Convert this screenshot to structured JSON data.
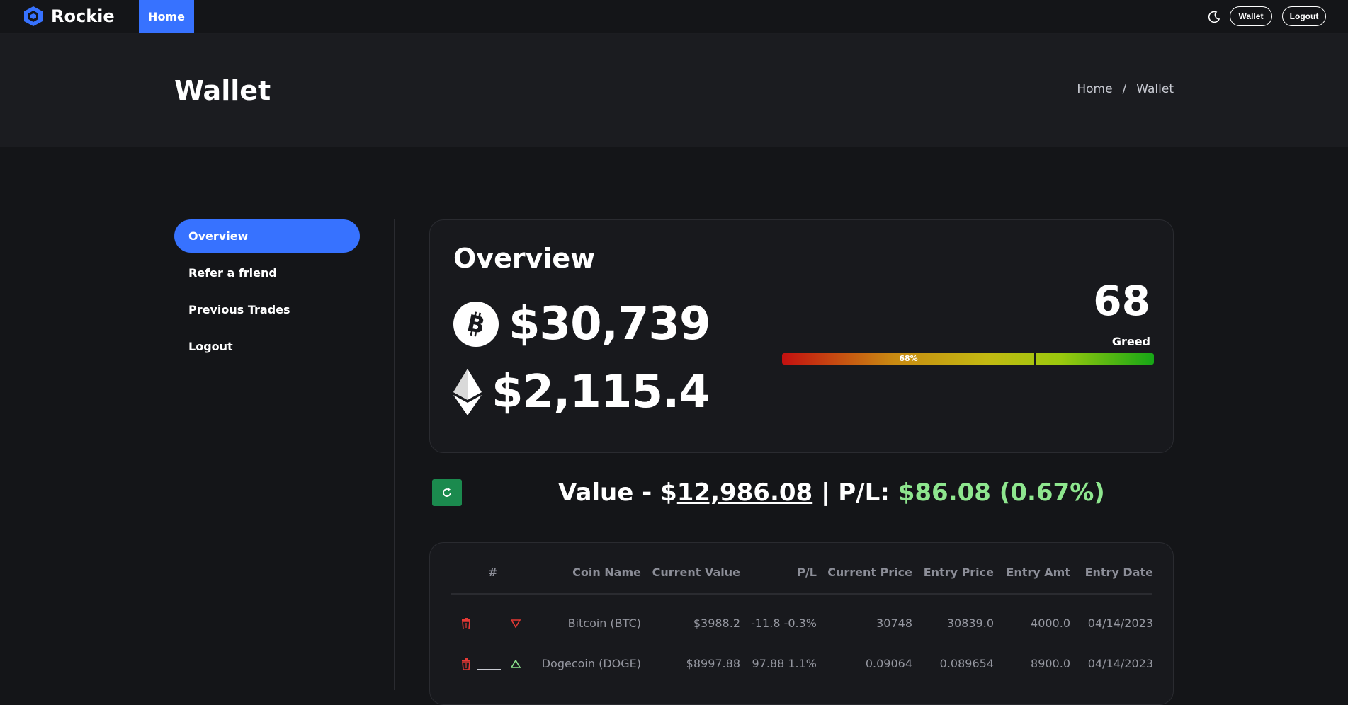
{
  "topbar": {
    "brand": "Rockie",
    "nav_home": "Home",
    "wallet_btn": "Wallet",
    "logout_btn": "Logout",
    "icons": [
      "logo-icon",
      "moon-icon"
    ]
  },
  "header": {
    "title": "Wallet",
    "breadcrumb": [
      "Home",
      "/",
      "Wallet"
    ]
  },
  "sidebar": {
    "items": [
      {
        "label": "Overview",
        "active": true
      },
      {
        "label": "Refer a friend",
        "active": false
      },
      {
        "label": "Previous Trades",
        "active": false
      },
      {
        "label": "Logout",
        "active": false
      }
    ]
  },
  "overview": {
    "title": "Overview",
    "btc_price": "$30,739",
    "eth_price": "$2,115.4",
    "greed_index": "68",
    "greed_label": "Greed",
    "greed_percent_label": "68%",
    "greed_fraction": 0.68
  },
  "value_line": {
    "prefix": "Value - $",
    "amount": "12,986.08",
    "separator": " | P/L: ",
    "pl": "$86.08 (0.67%)"
  },
  "table": {
    "headers": [
      "#",
      "Coin Name",
      "Current Value",
      "P/L",
      "Current Price",
      "Entry Price",
      "Entry Amt",
      "Entry Date"
    ],
    "rows": [
      {
        "coin": "Bitcoin (BTC)",
        "current_value": "$3988.2",
        "pl": "-11.8 -0.3%",
        "current_price": "30748",
        "entry_price": "30839.0",
        "entry_amt": "4000.0",
        "entry_date": "04/14/2023",
        "trend": "down"
      },
      {
        "coin": "Dogecoin (DOGE)",
        "current_value": "$8997.88",
        "pl": "97.88 1.1%",
        "current_price": "0.09064",
        "entry_price": "0.089654",
        "entry_amt": "8900.0",
        "entry_date": "04/14/2023",
        "trend": "up"
      }
    ]
  },
  "colors": {
    "accent": "#3772ff",
    "background": "#141518",
    "card": "#18191d",
    "positive": "#8ee68e",
    "negative": "#e53935",
    "refresh": "#1b8a4e"
  }
}
